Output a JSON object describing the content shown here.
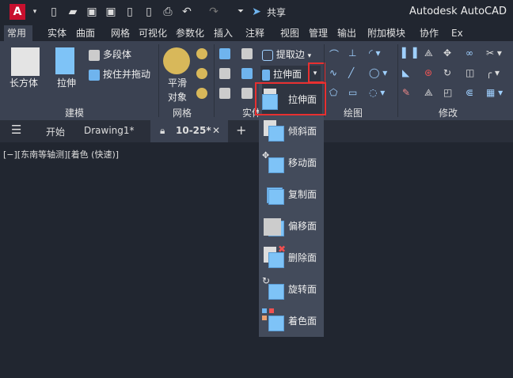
{
  "titlebar": {
    "logo": "A",
    "share": "共享",
    "app_title": "Autodesk AutoCAD"
  },
  "tabs": [
    "常用",
    "实体",
    "曲面",
    "网格",
    "可视化",
    "参数化",
    "插入",
    "注释",
    "视图",
    "管理",
    "输出",
    "附加模块",
    "协作",
    "Ex"
  ],
  "ribbon": {
    "modeling": {
      "box": "长方体",
      "extrude": "拉伸",
      "polysolid": "多段体",
      "presspull": "按住并拖动",
      "label": "建模"
    },
    "mesh": {
      "smooth": "平滑\n对象",
      "smooth1": "平滑",
      "smooth2": "对象",
      "label": "网格"
    },
    "solid": {
      "extract_edges": "提取边",
      "extrude_faces": "拉伸面",
      "label": "实体"
    },
    "draw": {
      "label": "绘图"
    },
    "modify": {
      "label": "修改"
    }
  },
  "doc_tabs": {
    "start": "开始",
    "drawing1": "Drawing1*",
    "active": "10-25*"
  },
  "viewport_label": "[−][东南等轴测][着色 (快速)]",
  "dropdown": [
    "拉伸面",
    "倾斜面",
    "移动面",
    "复制面",
    "偏移面",
    "删除面",
    "旋转面",
    "着色面"
  ]
}
